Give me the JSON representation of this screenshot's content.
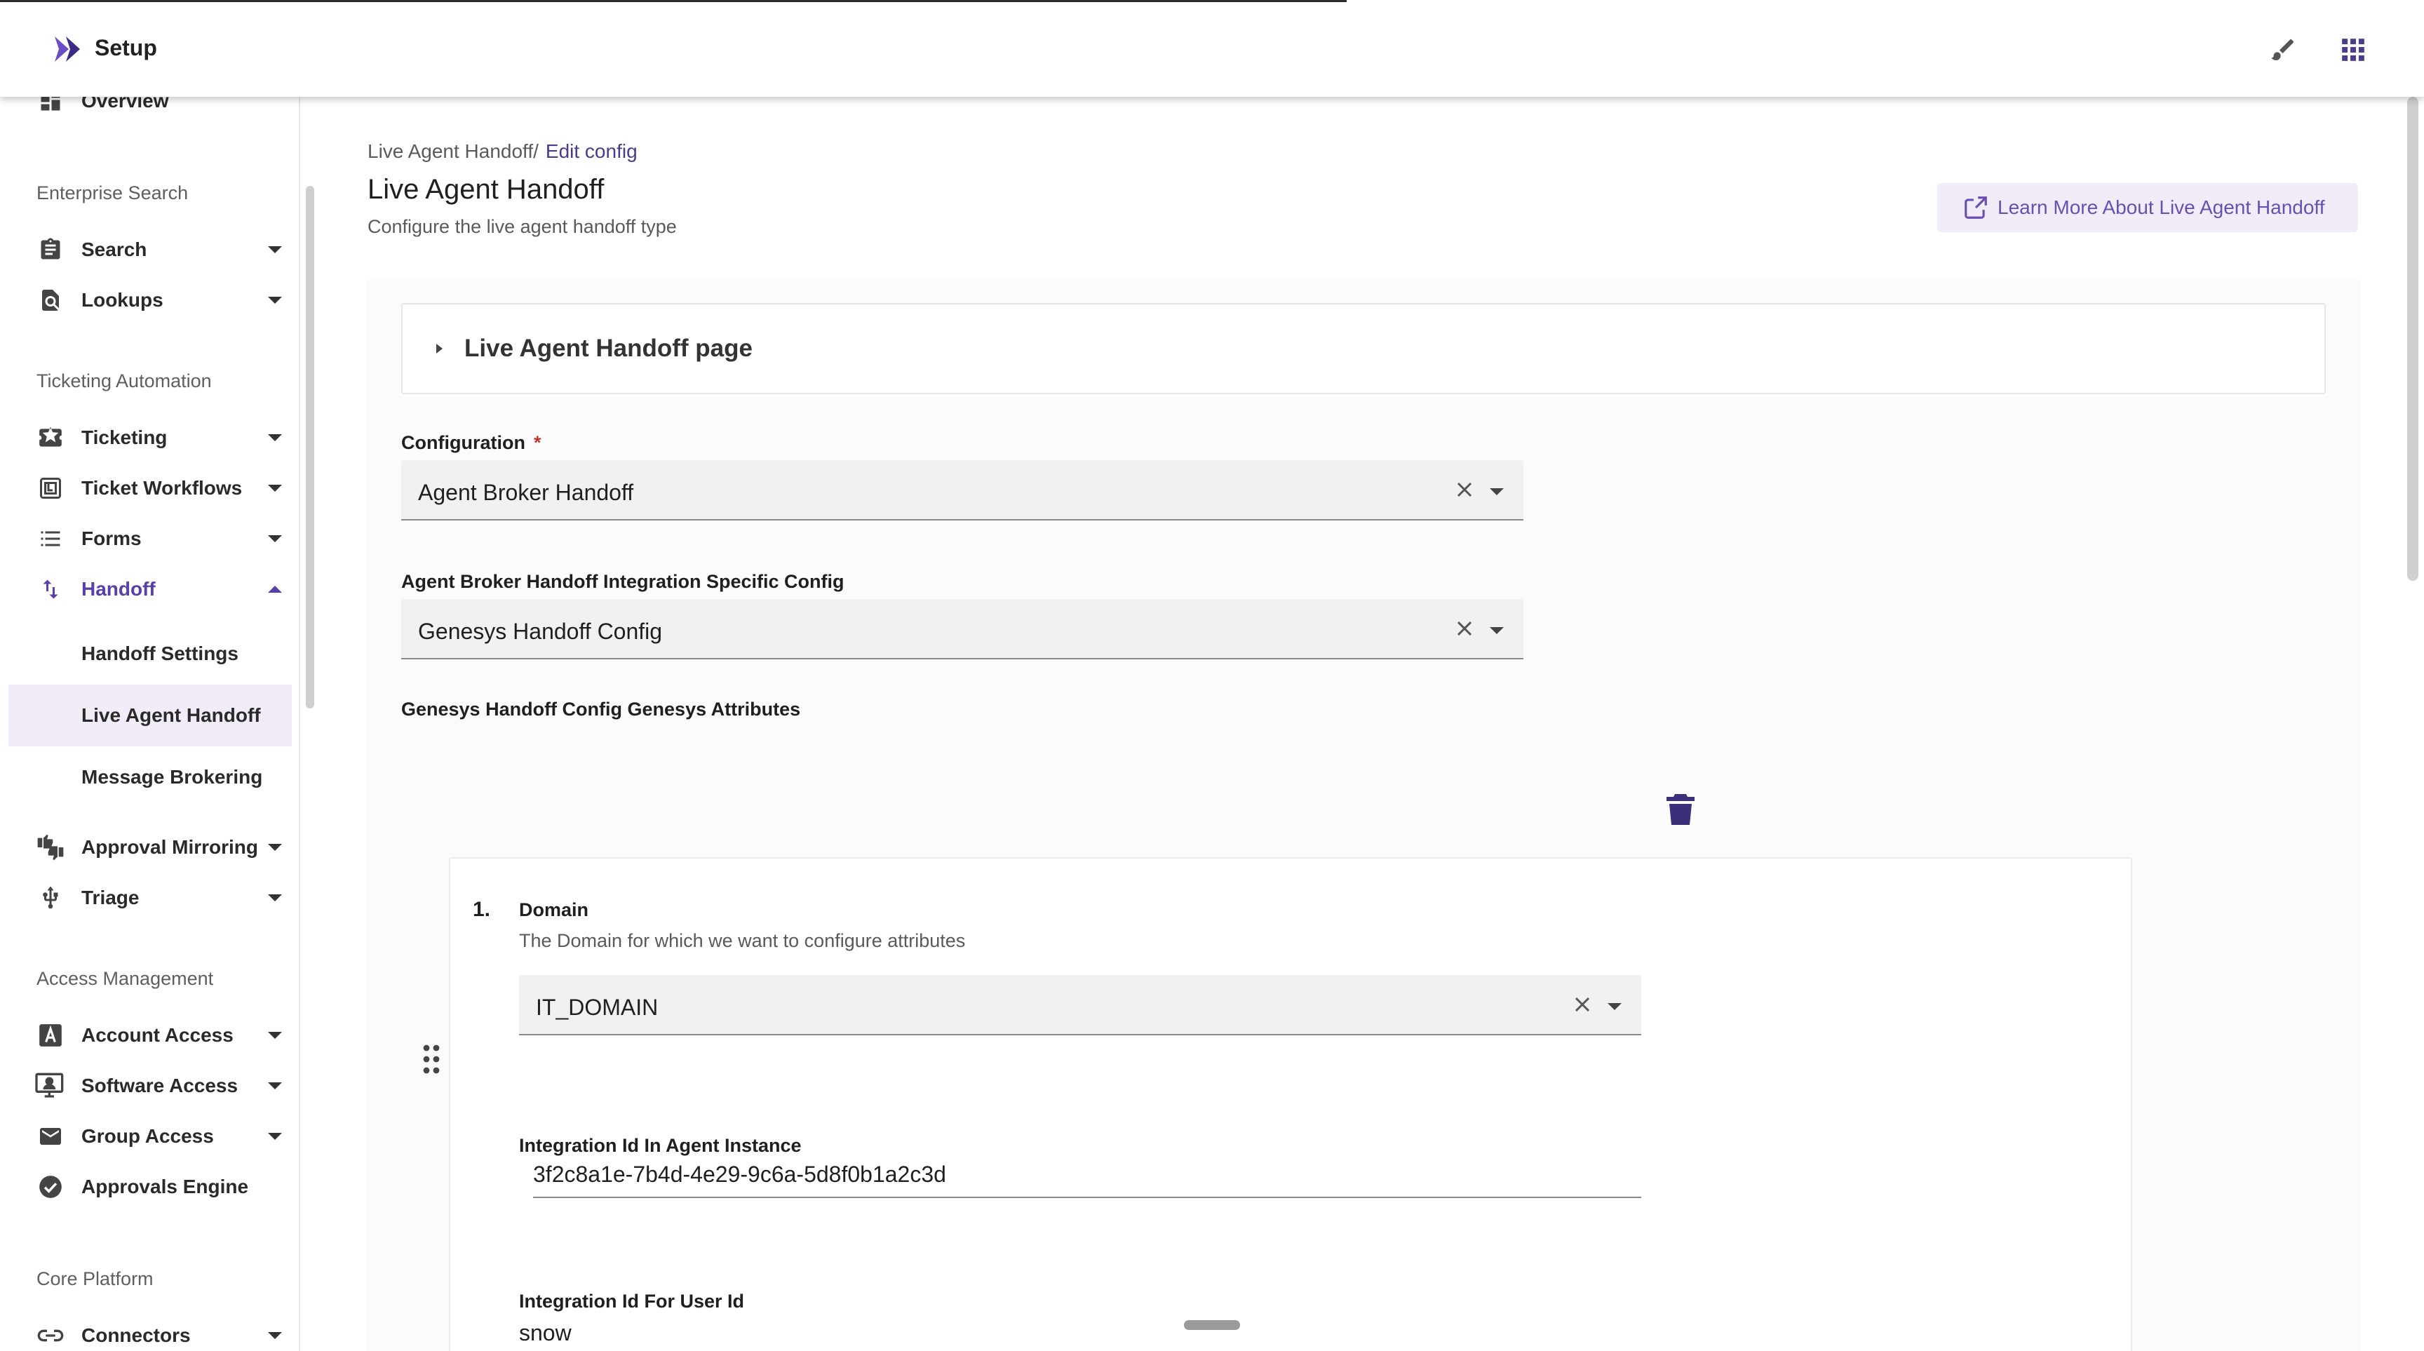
{
  "header": {
    "title": "Setup",
    "logo_icon": "setup-logo-icon",
    "edit_icon": "brush-icon",
    "apps_icon": "apps-grid-icon"
  },
  "sidebar": {
    "overview": "Overview",
    "sections": {
      "enterprise_search": "Enterprise Search",
      "ticketing_automation": "Ticketing Automation",
      "access_management": "Access Management",
      "core_platform": "Core Platform"
    },
    "items": {
      "search": "Search",
      "lookups": "Lookups",
      "ticketing": "Ticketing",
      "ticket_workflows": "Ticket Workflows",
      "forms": "Forms",
      "handoff": "Handoff",
      "handoff_settings": "Handoff Settings",
      "live_agent_handoff": "Live Agent Handoff",
      "message_brokering": "Message Brokering",
      "approval_mirroring": "Approval Mirroring",
      "triage": "Triage",
      "account_access": "Account Access",
      "software_access": "Software Access",
      "group_access": "Group Access",
      "approvals_engine": "Approvals Engine",
      "connectors": "Connectors"
    }
  },
  "main": {
    "breadcrumb": {
      "parent": "Live Agent Handoff",
      "separator": "/",
      "current": "Edit config"
    },
    "title": "Live Agent Handoff",
    "subtitle": "Configure the live agent handoff type",
    "learn_more": "Learn More About Live Agent Handoff",
    "collapse_title": "Live Agent Handoff page",
    "configuration": {
      "label": "Configuration",
      "required": "*",
      "value": "Agent Broker Handoff"
    },
    "integration_config": {
      "label": "Agent Broker Handoff Integration Specific Config",
      "value": "Genesys Handoff Config"
    },
    "attributes_label": "Genesys Handoff Config Genesys Attributes",
    "item": {
      "number": "1.",
      "domain_label": "Domain",
      "domain_desc": "The Domain for which we want to configure attributes",
      "domain_value": "IT_DOMAIN",
      "agent_instance_label": "Integration Id In Agent Instance",
      "agent_instance_value": "3f2c8a1e-7b4d-4e29-9c6a-5d8f0b1a2c3d",
      "user_id_label": "Integration Id For User Id",
      "user_id_value": "snow"
    }
  },
  "colors": {
    "accent": "#5b3fa8",
    "active_bg": "#f1ecf8",
    "required": "#c0392b"
  }
}
